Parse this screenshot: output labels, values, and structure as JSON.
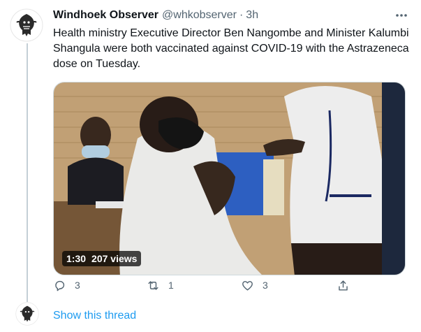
{
  "tweet": {
    "display_name": "Windhoek Observer",
    "handle": "@whkobserver",
    "separator": "·",
    "time": "3h",
    "text": "Health ministry Executive Director Ben Nangombe and Minister Kalumbi Shangula were both vaccinated against COVID-19 with the Astrazeneca dose on Tuesday.",
    "media": {
      "type": "video",
      "duration": "1:30",
      "views": "207 views"
    },
    "actions": {
      "reply_count": "3",
      "retweet_count": "1",
      "like_count": "3"
    }
  },
  "show_thread": "Show this thread",
  "icons": [
    "avatar-logo",
    "more-icon",
    "reply-icon",
    "retweet-icon",
    "like-icon",
    "share-icon"
  ],
  "colors": {
    "link": "#1d9bf0",
    "secondary_text": "#536471",
    "thread_line": "#c4cfd6"
  }
}
